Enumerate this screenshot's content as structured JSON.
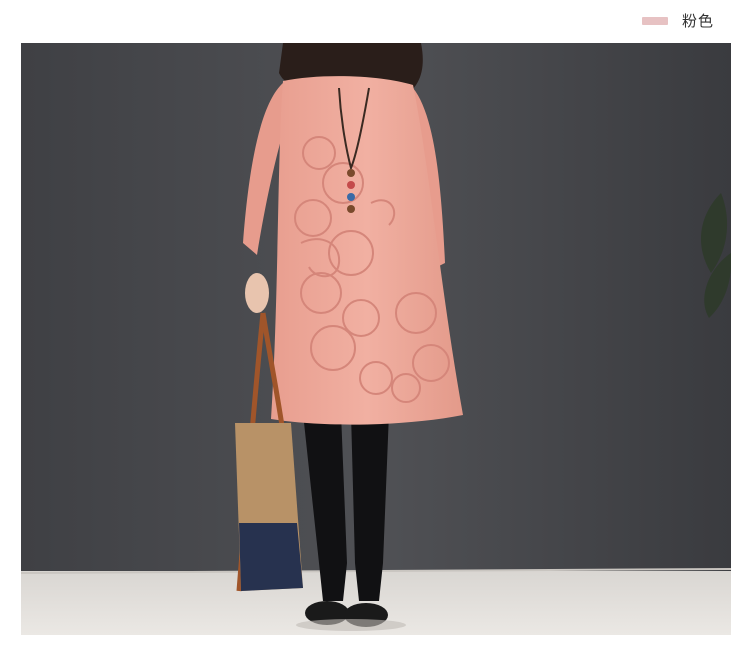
{
  "variant": {
    "label": "粉色",
    "swatch_color": "#e7c2c3"
  },
  "product_photo": {
    "subject": "pink-embroidered-dress-model",
    "wall_color": "#4a4b4f",
    "floor_color": "#e3e0dc",
    "dress_color": "#eeaa9c"
  }
}
